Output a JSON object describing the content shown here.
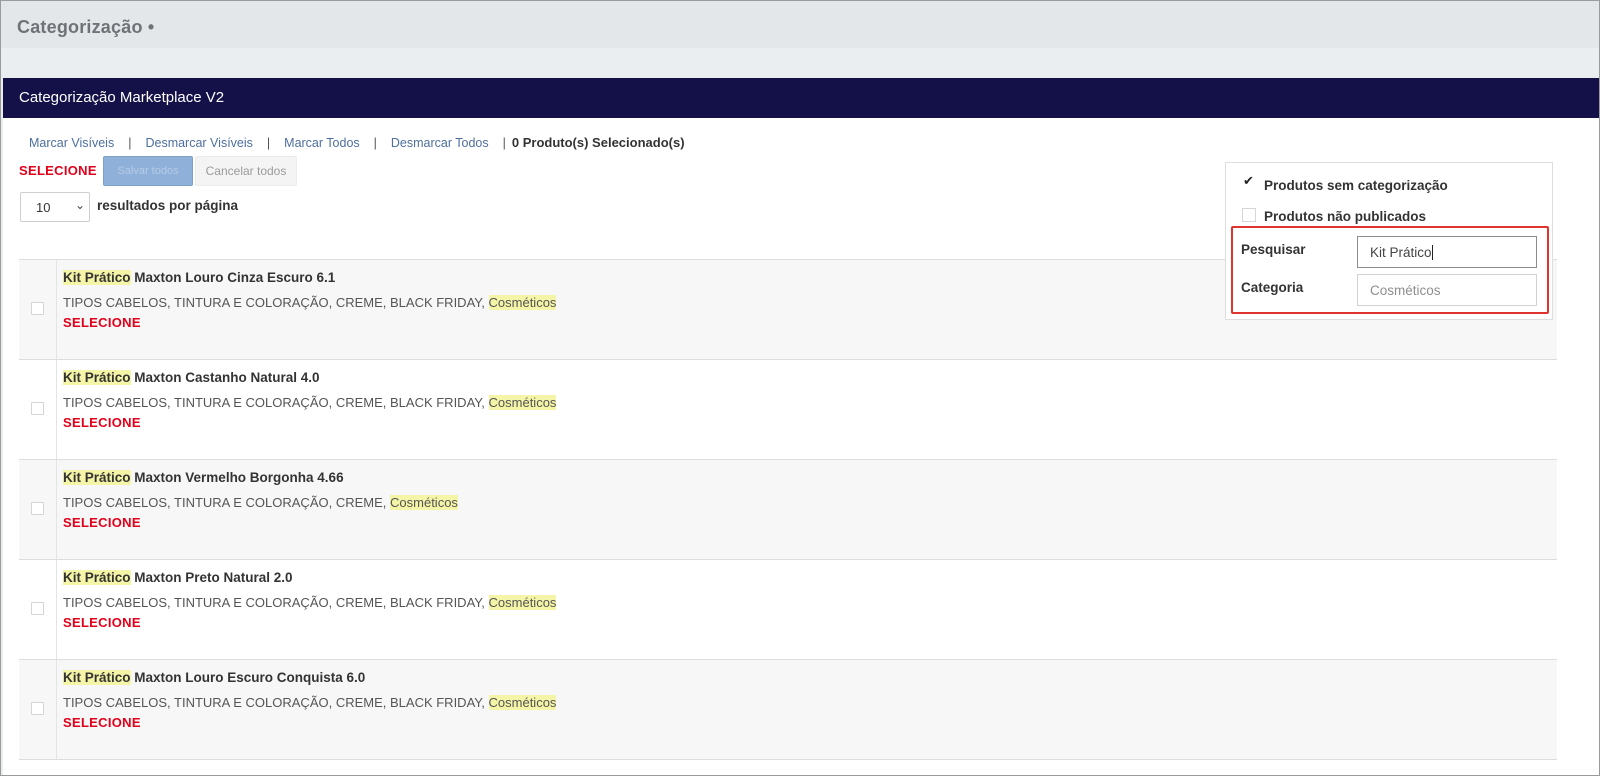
{
  "page": {
    "title": "Categorização •"
  },
  "panel": {
    "title": "Categorização Marketplace V2"
  },
  "selection_links": {
    "mark_visible": "Marcar Visíveis",
    "unmark_visible": "Desmarcar Visíveis",
    "mark_all": "Marcar Todos",
    "unmark_all": "Desmarcar Todos",
    "separator": "|",
    "selected_count": "0 Produto(s) Selecionado(s)"
  },
  "bulk": {
    "label": "SELECIONE",
    "select_all": "Salvar todos",
    "cancel_all": "Cancelar todos"
  },
  "pagination": {
    "per_page_value": "10",
    "per_page_label": "resultados por página"
  },
  "filters": {
    "no_category": {
      "label": "Produtos sem categorização",
      "checked": true
    },
    "unpublished": {
      "label": "Produtos não publicados",
      "checked": false
    },
    "search": {
      "label": "Pesquisar",
      "value": "Kit Prático"
    },
    "category": {
      "label": "Categoria",
      "placeholder": "Cosméticos"
    }
  },
  "products": [
    {
      "highlight": "Kit Prático",
      "name": "Maxton Louro Cinza Escuro 6.1",
      "categories": "TIPOS CABELOS, TINTURA E COLORAÇÃO, CREME, BLACK FRIDAY,",
      "category_highlight": "Cosméticos",
      "select_label": "SELECIONE"
    },
    {
      "highlight": "Kit Prático",
      "name": "Maxton Castanho Natural 4.0",
      "categories": "TIPOS CABELOS, TINTURA E COLORAÇÃO, CREME, BLACK FRIDAY,",
      "category_highlight": "Cosméticos",
      "select_label": "SELECIONE"
    },
    {
      "highlight": "Kit Prático",
      "name": "Maxton Vermelho Borgonha 4.66",
      "categories": "TIPOS CABELOS, TINTURA E COLORAÇÃO, CREME,",
      "category_highlight": "Cosméticos",
      "select_label": "SELECIONE"
    },
    {
      "highlight": "Kit Prático",
      "name": "Maxton Preto Natural 2.0",
      "categories": "TIPOS CABELOS, TINTURA E COLORAÇÃO, CREME, BLACK FRIDAY,",
      "category_highlight": "Cosméticos",
      "select_label": "SELECIONE"
    },
    {
      "highlight": "Kit Prático",
      "name": "Maxton Louro Escuro Conquista 6.0",
      "categories": "TIPOS CABELOS, TINTURA E COLORAÇÃO, CREME, BLACK FRIDAY,",
      "category_highlight": "Cosméticos",
      "select_label": "SELECIONE"
    }
  ],
  "colors": {
    "header_bg": "#131148",
    "select_red": "#e3001b",
    "highlight": "#f5f5a8",
    "link": "#4e6f9e",
    "focus_outline": "#e0332f"
  }
}
